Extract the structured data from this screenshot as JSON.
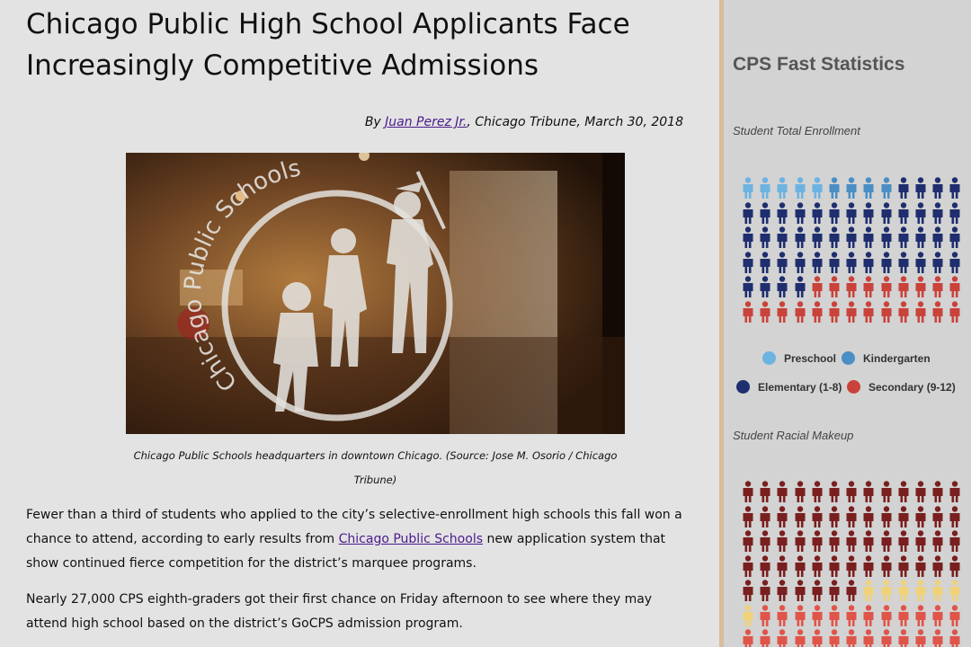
{
  "article": {
    "headline": "Chicago Public High School Applicants Face Increasingly Competitive Admissions",
    "byline_prefix": "By ",
    "author": "Juan Perez Jr.",
    "byline_suffix": ", Chicago Tribune, March 30, 2018",
    "photo_caption": "Chicago Public Schools headquarters in downtown Chicago. (Source: Jose M. Osorio / Chicago Tribune)",
    "photo_glass_text_top": "Chicago Public Schools",
    "paragraph1_a": "Fewer than a third of students who applied to the city’s selective-enrollment high schools this fall won a chance to attend, according to early results from ",
    "paragraph1_link": "Chicago Public Schools",
    "paragraph1_b": " new application system that show continued fierce competition for the district’s marquee programs.",
    "paragraph2": "Nearly 27,000 CPS eighth-graders got their first chance on Friday afternoon to see where they may attend high school based on the district’s GoCPS admission program."
  },
  "sidebar": {
    "title": "CPS Fast Statistics",
    "enrollment_label": "Student Total Enrollment",
    "racial_label": "Student Racial Makeup",
    "legend": [
      {
        "label": "Preschool",
        "color": "#6cb3e2"
      },
      {
        "label": "Kindergarten",
        "color": "#4a8ec4"
      },
      {
        "label": "Elementary (1-8)",
        "color": "#1f2e6e"
      },
      {
        "label": "Secondary (9-12)",
        "color": "#c9433b"
      }
    ],
    "enrollment_icons": {
      "columns": 13,
      "rows": 6,
      "counts": [
        {
          "category": "Preschool",
          "count": 5,
          "color": "#6cb3e2"
        },
        {
          "category": "Kindergarten",
          "count": 4,
          "color": "#4a8ec4"
        },
        {
          "category": "Elementary (1-8)",
          "count": 47,
          "color": "#1f2e6e"
        },
        {
          "category": "Secondary (9-12)",
          "count": 22,
          "color": "#c9433b"
        }
      ]
    },
    "racial_icons": {
      "columns": 13,
      "visible_rows": 7,
      "counts": [
        {
          "count": 59,
          "color": "#7a1f1f"
        },
        {
          "count": 7,
          "color": "#efd27a"
        },
        {
          "count": 25,
          "color": "#e0554a"
        }
      ]
    }
  }
}
